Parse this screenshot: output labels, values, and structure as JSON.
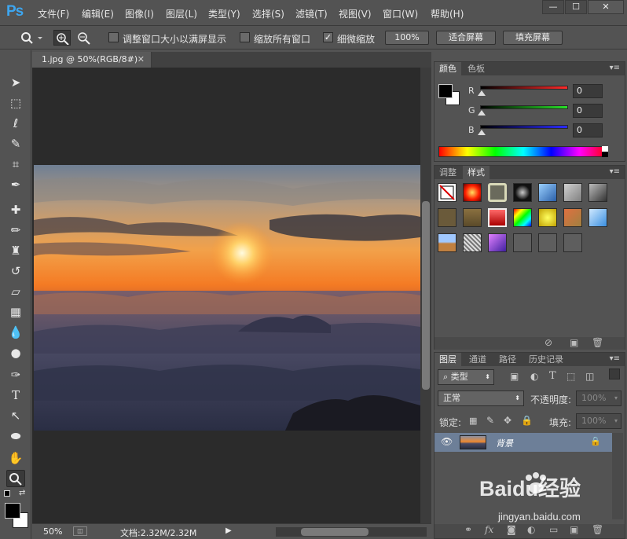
{
  "app": {
    "logo": "Ps"
  },
  "menu": [
    "文件(F)",
    "编辑(E)",
    "图像(I)",
    "图层(L)",
    "类型(Y)",
    "选择(S)",
    "滤镜(T)",
    "视图(V)",
    "窗口(W)",
    "帮助(H)"
  ],
  "window_controls": {
    "minimize": "—",
    "maximize": "☐",
    "close": "✕"
  },
  "options": {
    "resize_windows": "调整窗口大小以满屏显示",
    "zoom_all": "缩放所有窗口",
    "scrubby_zoom": "细微缩放",
    "scrubby_checked": true,
    "zoom_100": "100%",
    "fit_screen": "适合屏幕",
    "fill_screen": "填充屏幕"
  },
  "document": {
    "tab_title": "1.jpg @ 50%(RGB/8#)",
    "close": "✕"
  },
  "status": {
    "zoom": "50%",
    "doc_info": "文档:2.32M/2.32M"
  },
  "color_panel": {
    "tabs": [
      "颜色",
      "色板"
    ],
    "channels": [
      {
        "label": "R",
        "value": "0",
        "color": "#ff2a2a"
      },
      {
        "label": "G",
        "value": "0",
        "color": "#28e028"
      },
      {
        "label": "B",
        "value": "0",
        "color": "#2a2aff"
      }
    ]
  },
  "styles_panel": {
    "tabs": [
      "调整",
      "样式"
    ]
  },
  "layers_panel": {
    "tabs": [
      "图层",
      "通道",
      "路径",
      "历史记录"
    ],
    "filter_type": "类型",
    "blend_mode": "正常",
    "opacity_label": "不透明度:",
    "opacity_value": "100%",
    "lock_label": "锁定:",
    "fill_label": "填充:",
    "fill_value": "100%",
    "layers": [
      {
        "name": "背景",
        "locked": true,
        "visible": true
      }
    ]
  },
  "watermark": {
    "brand": "Baidu经验",
    "url": "jingyan.baidu.com"
  }
}
